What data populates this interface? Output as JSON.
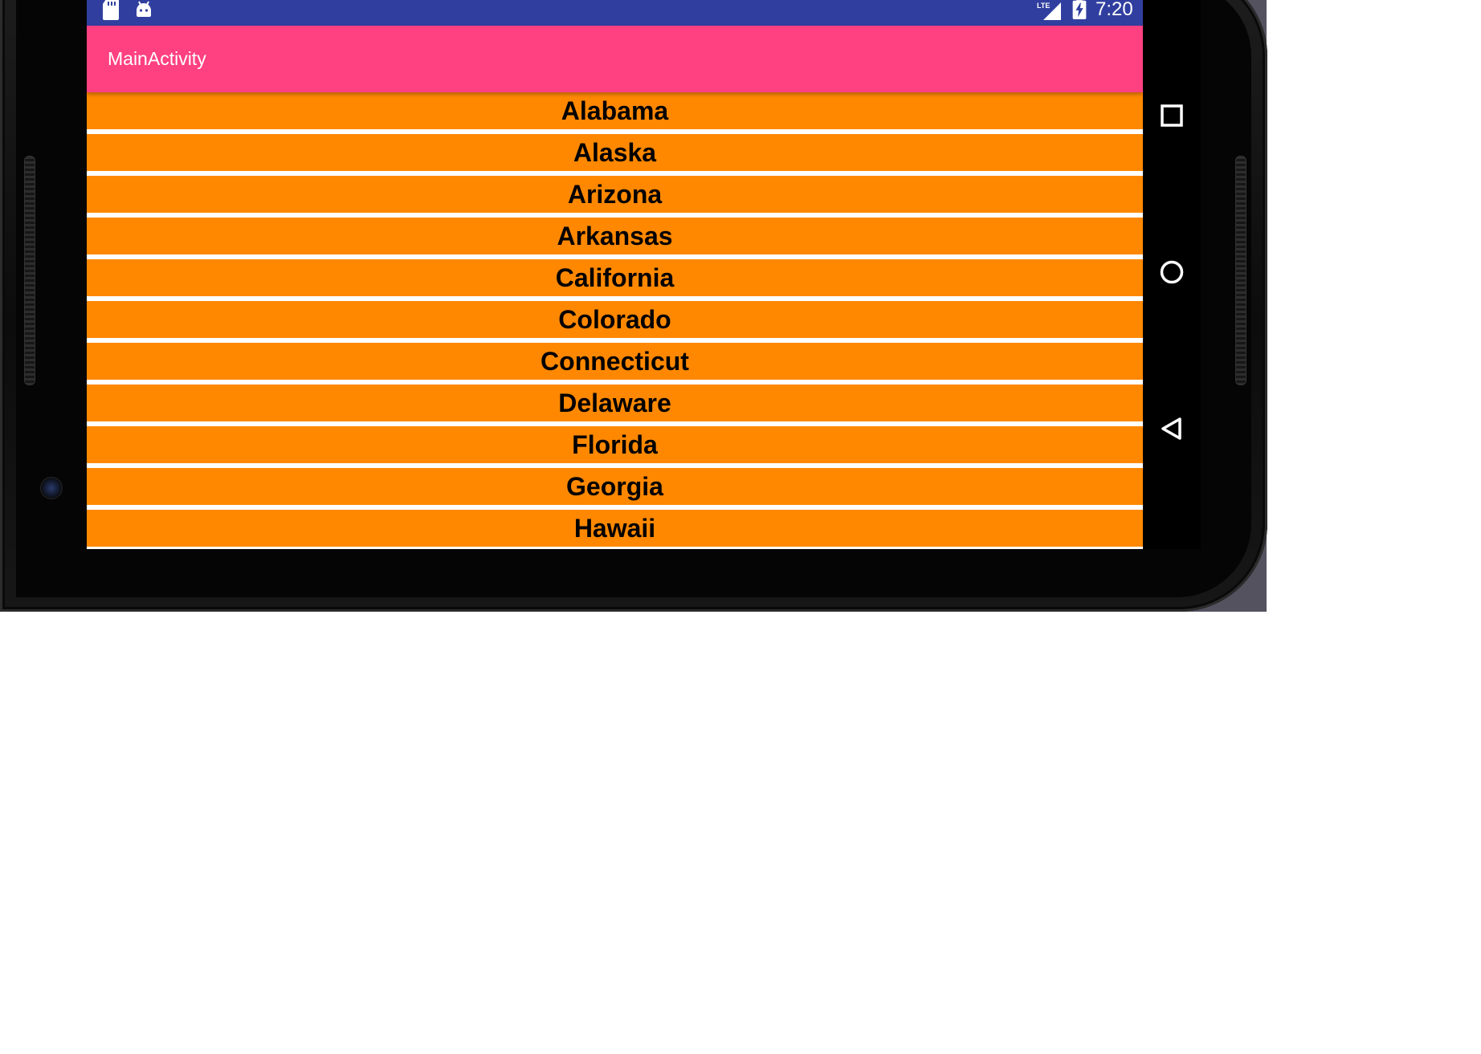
{
  "status_bar": {
    "time": "7:20",
    "icons": [
      "sd-card-icon",
      "android-debug-icon",
      "lte-signal-icon",
      "battery-charging-icon"
    ]
  },
  "app_bar": {
    "title": "MainActivity"
  },
  "list": {
    "items": [
      "Alabama",
      "Alaska",
      "Arizona",
      "Arkansas",
      "California",
      "Colorado",
      "Connecticut",
      "Delaware",
      "Florida",
      "Georgia",
      "Hawaii"
    ]
  },
  "nav_bar": {
    "buttons": [
      "recents-icon",
      "home-icon",
      "back-icon"
    ]
  },
  "colors": {
    "status_bar": "#303f9f",
    "app_bar": "#ff4081",
    "list_item": "#ff8800",
    "divider": "#ffffff",
    "item_text": "#000000"
  }
}
